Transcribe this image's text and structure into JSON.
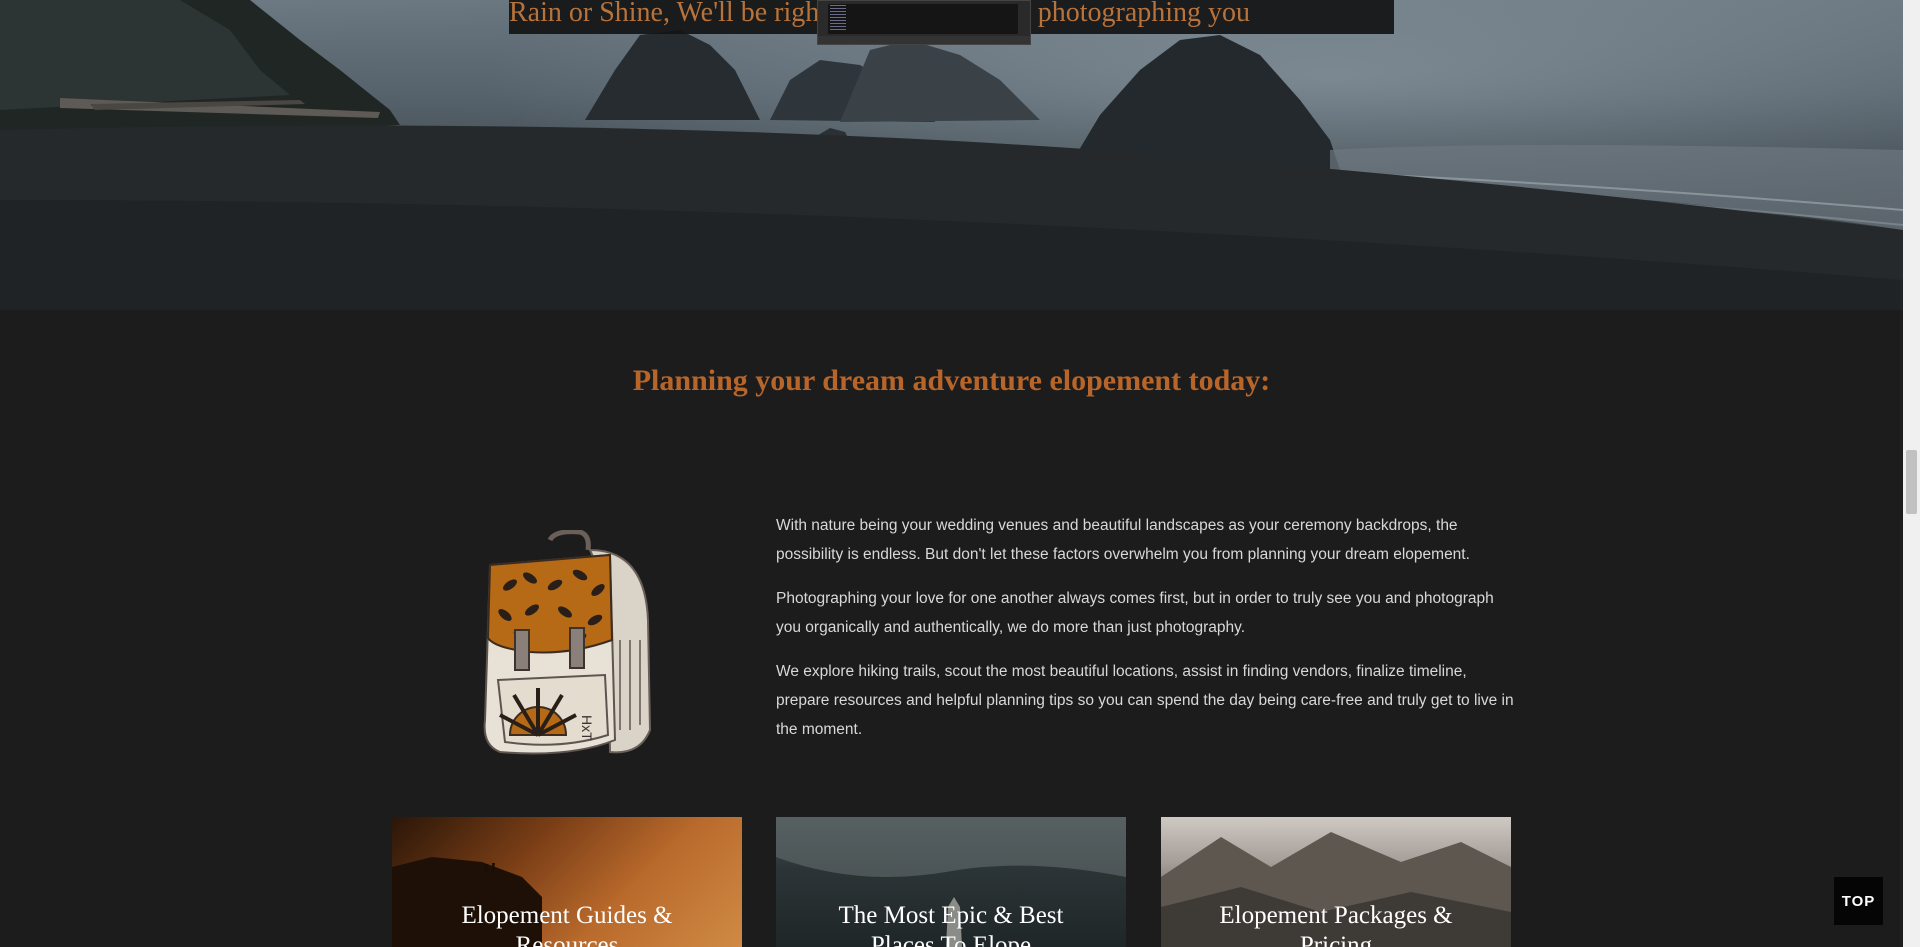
{
  "hero": {
    "banner_text": "Rain or Shine, We'll be right here guiding you, photographing you"
  },
  "section": {
    "title": "Planning your dream adventure elopement today:"
  },
  "intro": {
    "paragraphs": [
      "With nature being your wedding venues and beautiful landscapes as your ceremony backdrops, the possibility is endless. But don't let these factors overwhelm you from planning your dream elopement.",
      "Photographing your love for one another always comes first, but in order to truly see you and photograph you organically and authentically, we do more than just photography.",
      "We explore hiking trails, scout the most beautiful locations, assist in finding vendors, finalize timeline, prepare resources and helpful planning tips so you can spend the day being care-free and truly get to live in the moment."
    ]
  },
  "cards": [
    {
      "title": "Elopement Guides & Resources"
    },
    {
      "title": "The Most Epic & Best Places To Elope"
    },
    {
      "title": "Elopement Packages & Pricing"
    }
  ],
  "top_button": {
    "label": "TOP"
  },
  "colors": {
    "background": "#1c1c1c",
    "accent": "#b8652a",
    "body_text": "#d8d8d8"
  },
  "icons": {
    "backpack": "backpack-illustration"
  }
}
